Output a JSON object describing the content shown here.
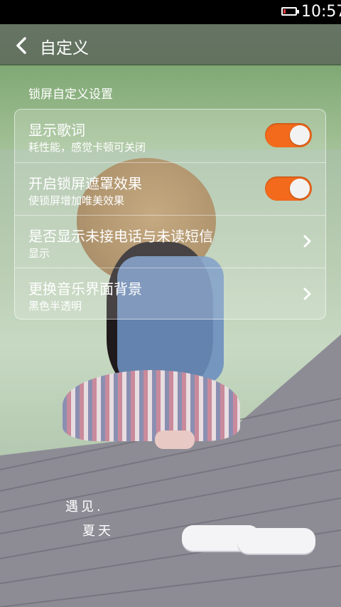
{
  "status_bar": {
    "time": "10:57",
    "battery_level_percent": 10
  },
  "header": {
    "title": "自定义"
  },
  "section": {
    "label": "锁屏自定义设置"
  },
  "settings": [
    {
      "label": "显示歌词",
      "sub": "耗性能，感觉卡顿可关闭",
      "control": "toggle",
      "checked": true
    },
    {
      "label": "开启锁屏遮罩效果",
      "sub": "使锁屏增加唯美效果",
      "control": "toggle",
      "checked": true
    },
    {
      "label": "是否显示未接电话与未读短信",
      "sub": "显示",
      "control": "chevron"
    },
    {
      "label": "更换音乐界面背景",
      "sub": "黑色半透明",
      "control": "chevron"
    }
  ],
  "wallpaper_text": {
    "line1": "遇见.",
    "line2": "夏天"
  },
  "colors": {
    "toggle_on": "#f36a1c",
    "status_bar": "#000000"
  },
  "icons": {
    "back": "chevron-left-icon",
    "next": "chevron-right-icon",
    "battery": "battery-icon"
  }
}
